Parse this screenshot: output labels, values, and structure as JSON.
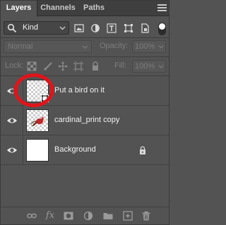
{
  "tabs": [
    {
      "label": "Layers",
      "active": true
    },
    {
      "label": "Channels",
      "active": false
    },
    {
      "label": "Paths",
      "active": false
    }
  ],
  "filter": {
    "kind_label": "Kind",
    "icons": [
      "pixel-filter-icon",
      "adjustment-filter-icon",
      "type-filter-icon",
      "shape-filter-icon",
      "smart-object-filter-icon"
    ]
  },
  "blend": {
    "mode": "Normal",
    "opacity_label": "Opacity:",
    "opacity_value": "100%"
  },
  "lock": {
    "label": "Lock:",
    "fill_label": "Fill:",
    "fill_value": "100%"
  },
  "layers": [
    {
      "name": "Put a bird on it",
      "type": "smart-object",
      "visible": true,
      "highlighted": true
    },
    {
      "name": "cardinal_print copy",
      "type": "pixel",
      "visible": true
    },
    {
      "name": "Background",
      "type": "background",
      "visible": true,
      "locked": true
    }
  ],
  "colors": {
    "panel_bg": "#535353",
    "tabbar_bg": "#3f3f3f",
    "highlight_circle": "#e0141b"
  },
  "bottom_icons": [
    "link-layers-icon",
    "fx-icon",
    "add-mask-icon",
    "adjustment-layer-icon",
    "new-group-icon",
    "new-layer-icon",
    "delete-icon"
  ]
}
